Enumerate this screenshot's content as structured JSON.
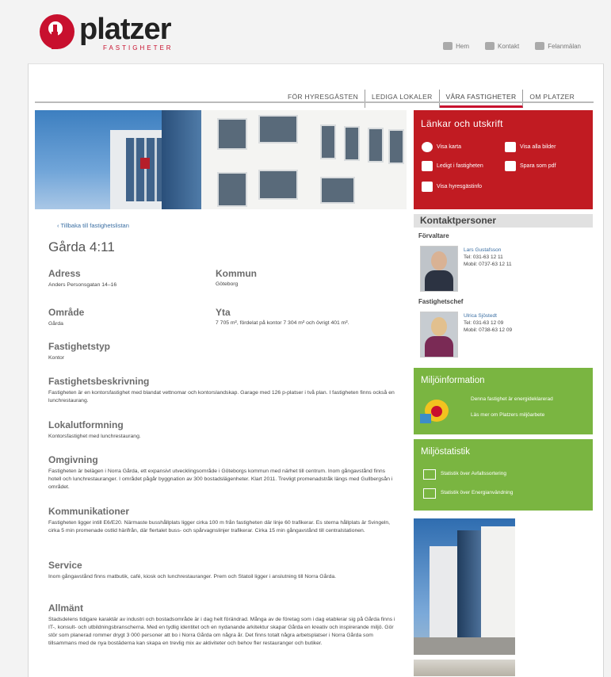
{
  "brand": {
    "name": "platzer",
    "sub": "FASTIGHETER",
    "color": "#c8102e"
  },
  "top_links": [
    {
      "label": "Hem",
      "icon": "home-icon"
    },
    {
      "label": "Kontakt",
      "icon": "phone-icon"
    },
    {
      "label": "Felanmälan",
      "icon": "wrench-icon"
    }
  ],
  "nav": [
    "FÖR HYRESGÄSTEN",
    "LEDIGA LOKALER",
    "VÅRA FASTIGHETER",
    "OM PLATZER"
  ],
  "nav_active": "VÅRA FASTIGHETER",
  "back_link": "‹ Tillbaka till fastighetslistan",
  "property_title": "Gårda 4:11",
  "adress": {
    "label": "Adress",
    "value": "Anders Personsgatan 14–16"
  },
  "kommun": {
    "label": "Kommun",
    "value": "Göteborg"
  },
  "omrade": {
    "label": "Område",
    "value": "Gårda"
  },
  "yta": {
    "label": "Yta",
    "value": "7 705 m², fördelat på kontor 7 304 m² och övrigt 401 m²."
  },
  "fastighetstyp": {
    "label": "Fastighetstyp",
    "value": "Kontor"
  },
  "beskrivning": {
    "label": "Fastighetsbeskrivning",
    "value": "Fastigheten är en kontorsfastighet med blandat vettnomar och kontorslandskap. Garage med 126 p-platser i två plan. I fastigheten finns också en lunchrestaurang."
  },
  "lokalutformning": {
    "label": "Lokalutformning",
    "value": "Kontorsfastighet med lunchrestaurang."
  },
  "omgivning": {
    "label": "Omgivning",
    "value": "Fastigheten är belägen i Norra Gårda, ett expansivt utvecklingsområde i Göteborgs kommun med närhet till centrum. Inom gångavstånd finns hotell och lunchrestauranger. I området pågår byggnation av 300 bostadslägenheter. Klart 2011. Trevligt promenadstråk längs med Gullbergsån i området."
  },
  "kommunikationer": {
    "label": "Kommunikationer",
    "value": "Fastigheten ligger intill E6/E20. Närmaste busshållplats ligger cirka 100 m från fastigheten där linje 60 trafikerar. Es sterna hållplats är Svingeln, cirka 5 min promenade ostlid härifrån, där flertalet buss- och spårvagnslinjer trafikerar. Cirka 15 min gångavstånd till centralstationen."
  },
  "service": {
    "label": "Service",
    "value": "Inom gångavstånd finns matbutik, café, kiosk och lunchrestauranger. Prem och Statoil ligger i anslutning till Norra Gårda."
  },
  "allmant": {
    "label": "Allmänt",
    "value": "Stadsdelens tidigare karaktär av industri och bostadsområde är i dag helt förändrad. Många av de företag som i dag etablerar sig på Gårda finns i IT-, konsult- och utbildningsbranscherna. Med en tydlig identitet och en nydanande arkitektur skapar Gårda en kreativ och inspirerande miljö. Gör stör som planerad rommer drygt 3 000 personer att bo i Norra Gårda om några år. Det finns totalt några arbetsplatser i Norra Gårda som tillsammans med de nya bostäderna kan skapa en trevlig mix av aktiviteter och behov fler restauranger och butiker."
  },
  "links_box": {
    "title": "Länkar och utskrift",
    "items": [
      {
        "label": "Visa karta",
        "icon": "globe-icon"
      },
      {
        "label": "Visa alla bilder",
        "icon": "images-icon"
      },
      {
        "label": "Ledigt i fastigheten",
        "icon": "thumb-icon"
      },
      {
        "label": "Spara som pdf",
        "icon": "print-icon"
      },
      {
        "label": "Visa hyresgästinfo",
        "icon": "info-icon"
      }
    ]
  },
  "kontakt": {
    "title": "Kontaktpersoner",
    "persons": [
      {
        "role": "Förvaltare",
        "name": "Lars Gustafsson",
        "tel": "Tel: 031-63 12 11",
        "mob": "Mobil: 0737-63 12 11"
      },
      {
        "role": "Fastighetschef",
        "name": "Ulrica Sjöstedt",
        "tel": "Tel: 031-63 12 09",
        "mob": "Mobil: 0738-63 12 09"
      }
    ]
  },
  "miljoinfo": {
    "title": "Miljöinformation",
    "line1": "Denna fastighet är energideklarerad",
    "line2": "Läs mer om Platzers miljöarbete"
  },
  "miljostatistik": {
    "title": "Miljöstatistik",
    "line1": "Statistik över Avfallssortering",
    "line2": "Statistik över Energianvändning"
  }
}
